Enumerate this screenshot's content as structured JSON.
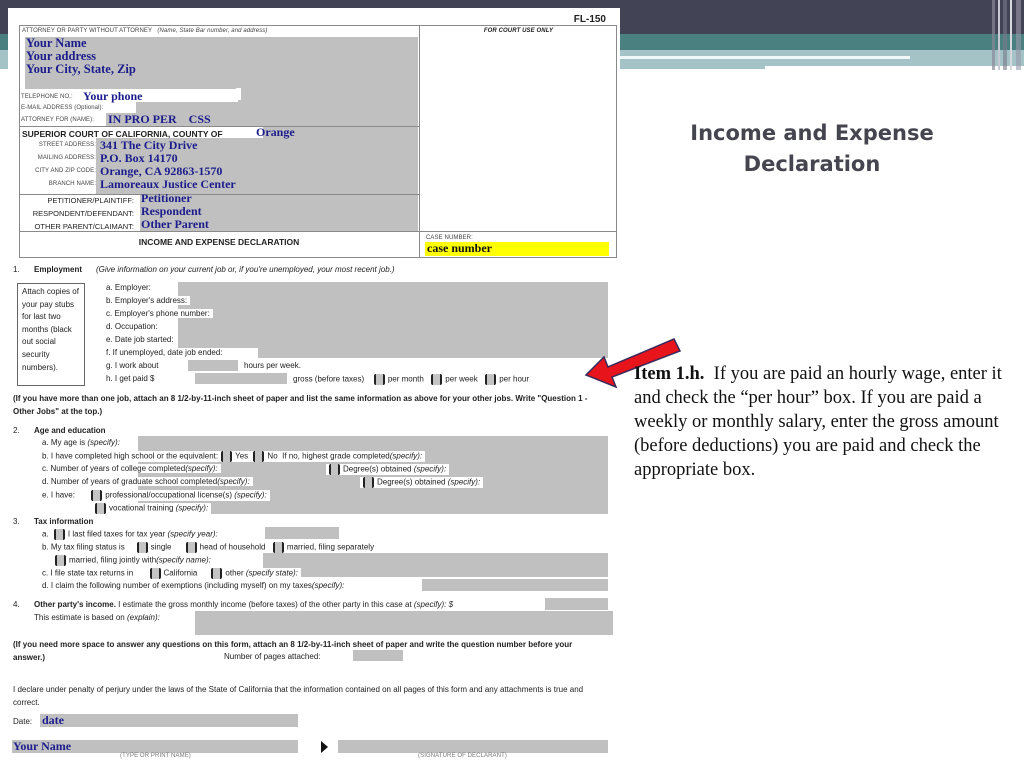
{
  "slide": {
    "title": "Income and Expense Declaration",
    "body_lead": "Item 1.h.",
    "body_text": "If you are paid an hourly wage, enter it and check the “per hour” box.  If you are paid a weekly or monthly salary, enter the gross amount (before deductions) you are paid and check the appropriate box.",
    "arrow_color": "#e8141c",
    "colors": {
      "header_dark": "#434356",
      "header_teal": "#4a8080",
      "header_light": "#a3c3c6"
    }
  },
  "form": {
    "form_code": "FL-150",
    "attorney_label": "ATTORNEY OR PARTY WITHOUT ATTORNEY",
    "attorney_hint": "(Name, State Bar number, and address)",
    "attorney_name": "Your Name",
    "attorney_address": "Your address",
    "attorney_city": "Your City, State, Zip",
    "telephone_label": "TELEPHONE NO.:",
    "telephone_value": "Your phone",
    "email_label": "E-MAIL ADDRESS (Optional):",
    "attorney_for_label": "ATTORNEY FOR (Name):",
    "attorney_for_value": "IN PRO PER    CSS",
    "court_use_label": "FOR COURT USE ONLY",
    "court_label": "SUPERIOR COURT OF CALIFORNIA, COUNTY OF",
    "county": "Orange",
    "street_label": "STREET ADDRESS:",
    "street_value": "341 The City Drive",
    "mailing_label": "MAILING ADDRESS:",
    "mailing_value": "P.O. Box 14170",
    "city_label": "CITY AND ZIP CODE:",
    "city_value": "Orange, CA 92863-1570",
    "branch_label": "BRANCH NAME:",
    "branch_value": "Lamoreaux Justice Center",
    "petitioner_label": "PETITIONER/PLAINTIFF:",
    "petitioner_value": "Petitioner",
    "respondent_label": "RESPONDENT/DEFENDANT:",
    "respondent_value": "Respondent",
    "other_parent_label": "OTHER PARENT/CLAIMANT:",
    "other_parent_value": "Other Parent",
    "form_title": "INCOME AND EXPENSE DECLARATION",
    "case_number_label": "CASE NUMBER:",
    "case_number_value": "case number",
    "case_number_highlight": "#ffff00",
    "s1": {
      "num": "1.",
      "title": "Employment",
      "hint": "(Give information on your current job or, if you're unemployed, your most recent job.)",
      "side_note": "Attach copies of your pay stubs for last two months (black out social security numbers).",
      "a": "a.  Employer:",
      "b": "b.  Employer's address:",
      "c": "c.  Employer's phone number:",
      "d": "d.  Occupation:",
      "e": "e.  Date job started:",
      "f": "f.   If unemployed, date job ended:",
      "g": "g.  I work about",
      "g_suffix": "hours per week.",
      "h": "h.  I get paid $",
      "h_suffix": "gross (before taxes)",
      "per_month": "per month",
      "per_week": "per week",
      "per_hour": "per hour",
      "note": "(If you have more than one job, attach an 8 1/2-by-11-inch sheet of paper and list the same information as above for your other jobs. Write \"Question 1 - Other Jobs\" at the top.)"
    },
    "s2": {
      "num": "2.",
      "title": "Age and education",
      "a": "a.  My age is",
      "b": "b.  I have completed high school or the equivalent:",
      "b_yes": "Yes",
      "b_no": "No",
      "b_if_no": "If no, highest grade completed",
      "c": "c.  Number of years of college completed",
      "c_degree": "Degree(s) obtained",
      "d": "d.  Number of years of graduate school completed",
      "d_degree": "Degree(s) obtained",
      "e": "e.  I have:",
      "e_license": "professional/occupational license(s)",
      "e_vocational": "vocational training",
      "specify": "(specify):"
    },
    "s3": {
      "num": "3.",
      "title": "Tax information",
      "a": "I last filed taxes for tax year",
      "a_hint": "(specify year):",
      "b": "b.  My tax filing status is",
      "b_single": "single",
      "b_hoh": "head of household",
      "b_mfs": "married, filing separately",
      "b_mfj": "married, filing jointly with",
      "b_mfj_hint": "(specify name):",
      "c": "c.  I file state tax returns in",
      "c_ca": "California",
      "c_other": "other",
      "c_other_hint": "(specify state):",
      "d": "d.  I claim the following number of exemptions (including myself) on my taxes",
      "d_hint": "(specify):"
    },
    "s4": {
      "num": "4.",
      "title": "Other party's income.",
      "text": "I estimate the gross monthly income (before taxes) of the other party in this case at",
      "specify": "(specify): $",
      "basis": "This estimate is based on",
      "basis_hint": "(explain):"
    },
    "more_space_note": "(If you need more space to answer any questions on this form, attach an 8 1/2-by-11-inch sheet of paper and write the question number before your answer.)",
    "pages_attached_label": "Number of pages attached:",
    "declaration": "I declare under penalty of perjury under the laws of the State of California that the information contained on all pages of this form and any attachments is true and correct.",
    "date_label": "Date:",
    "date_value": "date",
    "signer_name": "Your Name",
    "type_name_caption": "(TYPE OR PRINT NAME)",
    "signature_caption": "(SIGNATURE OF DECLARANT)"
  }
}
